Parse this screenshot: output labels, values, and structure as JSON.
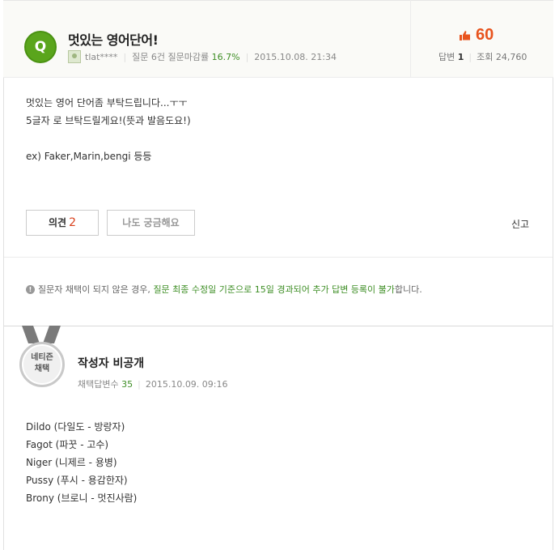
{
  "question": {
    "badge": "Q",
    "title": "멋있는 영어단어!",
    "author": "tlat****",
    "stats_label": "질문 6건 질문마감률",
    "close_rate": "16.7%",
    "datetime": "2015.10.08. 21:34",
    "up_count": "60",
    "answers_label": "답변",
    "answers_count": "1",
    "views_label": "조회",
    "views_count": "24,760",
    "body_lines": [
      "멋있는 영어 단어좀 부탁드립니다...ㅜㅜ",
      "5글자 로 브탁드릴게요!(뜻과 발음도요!)",
      "",
      "ex) Faker,Marin,bengi 등등"
    ],
    "opinion_label": "의견",
    "opinion_count": "2",
    "curious_label": "나도 궁금해요",
    "report_label": "신고"
  },
  "notice": {
    "prefix": "질문자 채택이 되지 않은 경우,",
    "highlight": "질문 최종 수정일 기준으로 15일 경과되어 추가 답변 등록이 불가",
    "suffix": "합니다."
  },
  "answer": {
    "medal_line1": "네티즌",
    "medal_line2": "채택",
    "author": "작성자 비공개",
    "adopted_label": "채택답변수",
    "adopted_count": "35",
    "datetime": "2015.10.09. 09:16",
    "body_lines": [
      "Dildo (다일도 - 방랑자)",
      "Fagot (파꿋 - 고수)",
      "Niger (니제르 - 용병)",
      "Pussy (푸시 - 용감한자)",
      "Brony (브로니 - 멋진사람)"
    ]
  },
  "colors": {
    "accent_green": "#3e8e25",
    "badge_green": "#5aa51c",
    "up_orange": "#e8531d"
  },
  "icons": [
    "question-badge-icon",
    "user-avatar-icon",
    "thumb-up-icon",
    "info-icon",
    "medal-icon"
  ]
}
